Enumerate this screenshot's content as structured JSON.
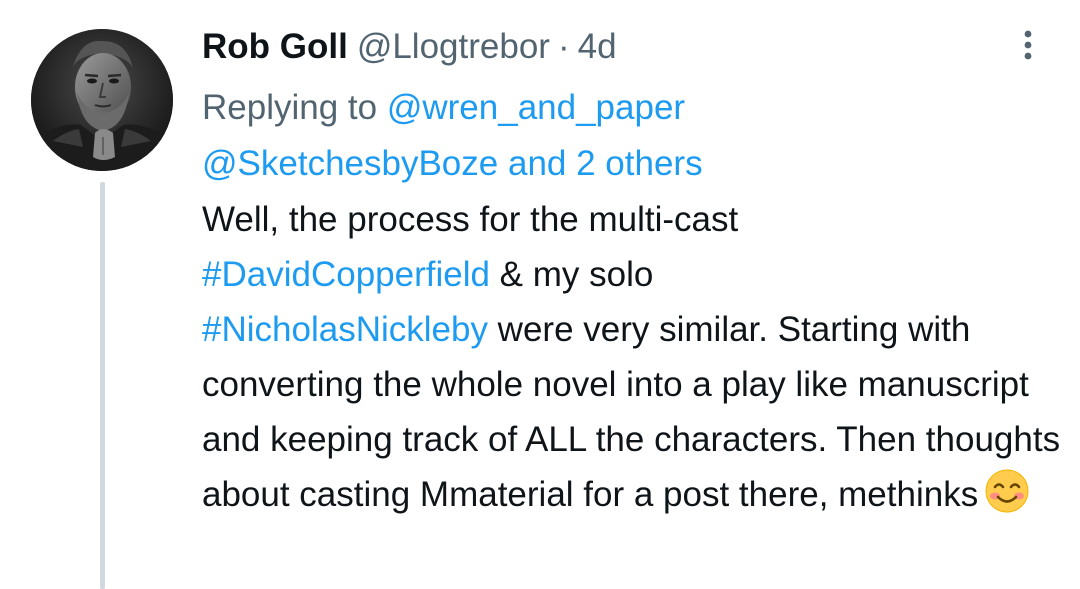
{
  "tweet": {
    "display_name": "Rob Goll",
    "handle": "@Llogtrebor",
    "separator": "·",
    "time": "4d",
    "reply": {
      "prefix": "Replying to",
      "mention_1": "@wren_and_paper",
      "mention_2": "@SketchesbyBoze",
      "others": "and 2 others"
    },
    "body": {
      "part_1": "Well, the process for the multi-cast",
      "hashtag_1": "#DavidCopperfield",
      "part_2": " & my solo",
      "hashtag_2": "#NicholasNickleby",
      "part_3": " were very similar. Starting with converting the whole novel into a play like manuscript and keeping track of ALL the characters. Then thoughts about casting Mmaterial for a post there, methinks",
      "emoji": "smiling-face-with-smiling-eyes-emoji"
    },
    "icons": {
      "more": "more-vertical-icon",
      "avatar": "profile-avatar"
    },
    "colors": {
      "link": "#1d9bf0",
      "secondary_text": "#536471",
      "primary_text": "#0f1419",
      "thread_line": "#cfd9de"
    }
  }
}
